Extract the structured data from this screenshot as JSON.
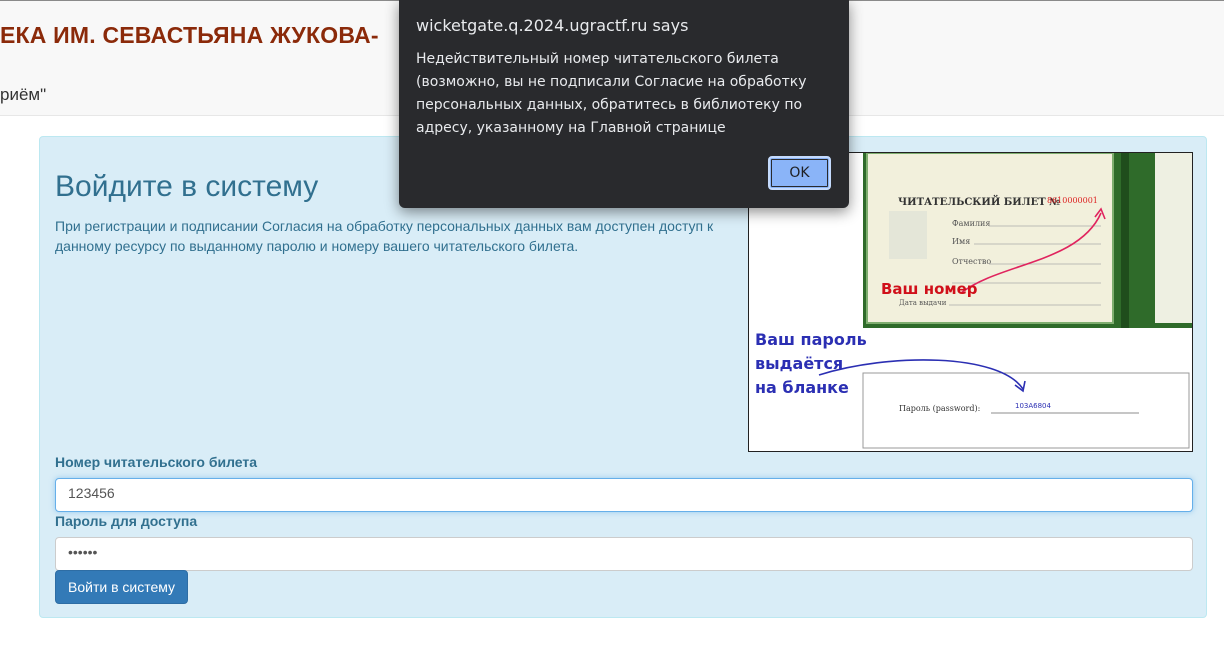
{
  "header": {
    "title": "ЕКА ИМ. СЕВАСТЬЯНА ЖУКОВА-",
    "subtitle": "риём\""
  },
  "login": {
    "heading": "Войдите в систему",
    "description": "При регистрации и подписании Согласия на обработку персональных данных вам доступен доступ к данному ресурсу по выданному паролю и номеру вашего читательского билета.",
    "card_label": "Номер читательского билета",
    "card_value": "123456",
    "password_label": "Пароль для доступа",
    "password_value": "••••••",
    "submit_label": "Войти в систему"
  },
  "ticket_image": {
    "ticket_title": "ЧИТАТЕЛЬСКИЙ БИЛЕТ №",
    "ticket_number": "8610000001",
    "field_surname": "Фамилия",
    "field_name": "Имя",
    "field_patronymic": "Отчество",
    "field_date": "Дата выдачи",
    "number_hint": "Ваш номер",
    "password_hint_1": "Ваш пароль",
    "password_hint_2": "выдаётся",
    "password_hint_3": "на бланке",
    "password_field": "Пароль (password):",
    "password_example": "103A6804"
  },
  "dialog": {
    "title": "wicketgate.q.2024.ugractf.ru says",
    "message": "Недействительный номер читательского билета (возможно, вы не подписали Согласие на обработку персональных данных, обратитесь в библиотеку по адресу, указанному на Главной странице",
    "ok_label": "OK"
  },
  "colors": {
    "title": "#8b2a0a",
    "panel_bg": "#d9edf7",
    "panel_text": "#31708f",
    "button": "#337ab7",
    "dialog_bg": "#292a2d",
    "dialog_button": "#8ab4f8"
  }
}
